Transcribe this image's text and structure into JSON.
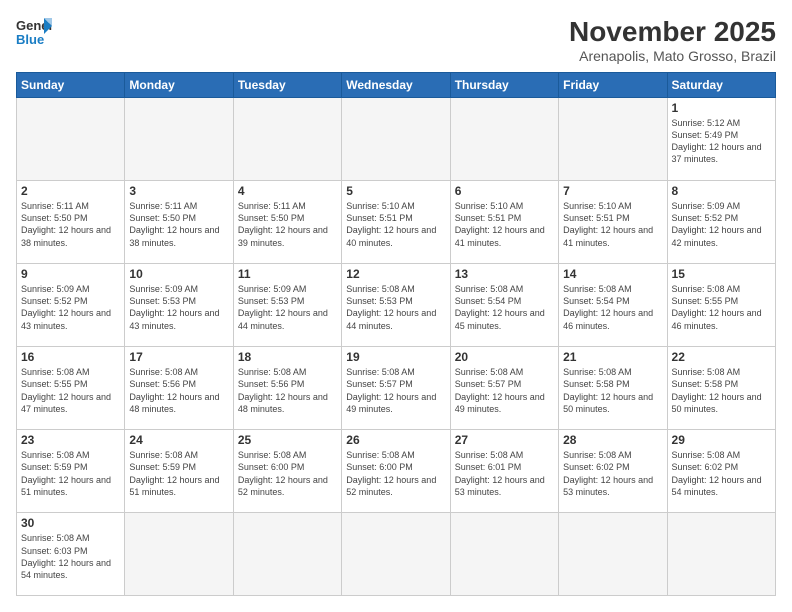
{
  "header": {
    "logo_general": "General",
    "logo_blue": "Blue",
    "month_title": "November 2025",
    "location": "Arenapolis, Mato Grosso, Brazil"
  },
  "weekdays": [
    "Sunday",
    "Monday",
    "Tuesday",
    "Wednesday",
    "Thursday",
    "Friday",
    "Saturday"
  ],
  "weeks": [
    [
      {
        "day": "",
        "info": ""
      },
      {
        "day": "",
        "info": ""
      },
      {
        "day": "",
        "info": ""
      },
      {
        "day": "",
        "info": ""
      },
      {
        "day": "",
        "info": ""
      },
      {
        "day": "",
        "info": ""
      },
      {
        "day": "1",
        "info": "Sunrise: 5:12 AM\nSunset: 5:49 PM\nDaylight: 12 hours and 37 minutes."
      }
    ],
    [
      {
        "day": "2",
        "info": "Sunrise: 5:11 AM\nSunset: 5:50 PM\nDaylight: 12 hours and 38 minutes."
      },
      {
        "day": "3",
        "info": "Sunrise: 5:11 AM\nSunset: 5:50 PM\nDaylight: 12 hours and 38 minutes."
      },
      {
        "day": "4",
        "info": "Sunrise: 5:11 AM\nSunset: 5:50 PM\nDaylight: 12 hours and 39 minutes."
      },
      {
        "day": "5",
        "info": "Sunrise: 5:10 AM\nSunset: 5:51 PM\nDaylight: 12 hours and 40 minutes."
      },
      {
        "day": "6",
        "info": "Sunrise: 5:10 AM\nSunset: 5:51 PM\nDaylight: 12 hours and 41 minutes."
      },
      {
        "day": "7",
        "info": "Sunrise: 5:10 AM\nSunset: 5:51 PM\nDaylight: 12 hours and 41 minutes."
      },
      {
        "day": "8",
        "info": "Sunrise: 5:09 AM\nSunset: 5:52 PM\nDaylight: 12 hours and 42 minutes."
      }
    ],
    [
      {
        "day": "9",
        "info": "Sunrise: 5:09 AM\nSunset: 5:52 PM\nDaylight: 12 hours and 43 minutes."
      },
      {
        "day": "10",
        "info": "Sunrise: 5:09 AM\nSunset: 5:53 PM\nDaylight: 12 hours and 43 minutes."
      },
      {
        "day": "11",
        "info": "Sunrise: 5:09 AM\nSunset: 5:53 PM\nDaylight: 12 hours and 44 minutes."
      },
      {
        "day": "12",
        "info": "Sunrise: 5:08 AM\nSunset: 5:53 PM\nDaylight: 12 hours and 44 minutes."
      },
      {
        "day": "13",
        "info": "Sunrise: 5:08 AM\nSunset: 5:54 PM\nDaylight: 12 hours and 45 minutes."
      },
      {
        "day": "14",
        "info": "Sunrise: 5:08 AM\nSunset: 5:54 PM\nDaylight: 12 hours and 46 minutes."
      },
      {
        "day": "15",
        "info": "Sunrise: 5:08 AM\nSunset: 5:55 PM\nDaylight: 12 hours and 46 minutes."
      }
    ],
    [
      {
        "day": "16",
        "info": "Sunrise: 5:08 AM\nSunset: 5:55 PM\nDaylight: 12 hours and 47 minutes."
      },
      {
        "day": "17",
        "info": "Sunrise: 5:08 AM\nSunset: 5:56 PM\nDaylight: 12 hours and 48 minutes."
      },
      {
        "day": "18",
        "info": "Sunrise: 5:08 AM\nSunset: 5:56 PM\nDaylight: 12 hours and 48 minutes."
      },
      {
        "day": "19",
        "info": "Sunrise: 5:08 AM\nSunset: 5:57 PM\nDaylight: 12 hours and 49 minutes."
      },
      {
        "day": "20",
        "info": "Sunrise: 5:08 AM\nSunset: 5:57 PM\nDaylight: 12 hours and 49 minutes."
      },
      {
        "day": "21",
        "info": "Sunrise: 5:08 AM\nSunset: 5:58 PM\nDaylight: 12 hours and 50 minutes."
      },
      {
        "day": "22",
        "info": "Sunrise: 5:08 AM\nSunset: 5:58 PM\nDaylight: 12 hours and 50 minutes."
      }
    ],
    [
      {
        "day": "23",
        "info": "Sunrise: 5:08 AM\nSunset: 5:59 PM\nDaylight: 12 hours and 51 minutes."
      },
      {
        "day": "24",
        "info": "Sunrise: 5:08 AM\nSunset: 5:59 PM\nDaylight: 12 hours and 51 minutes."
      },
      {
        "day": "25",
        "info": "Sunrise: 5:08 AM\nSunset: 6:00 PM\nDaylight: 12 hours and 52 minutes."
      },
      {
        "day": "26",
        "info": "Sunrise: 5:08 AM\nSunset: 6:00 PM\nDaylight: 12 hours and 52 minutes."
      },
      {
        "day": "27",
        "info": "Sunrise: 5:08 AM\nSunset: 6:01 PM\nDaylight: 12 hours and 53 minutes."
      },
      {
        "day": "28",
        "info": "Sunrise: 5:08 AM\nSunset: 6:02 PM\nDaylight: 12 hours and 53 minutes."
      },
      {
        "day": "29",
        "info": "Sunrise: 5:08 AM\nSunset: 6:02 PM\nDaylight: 12 hours and 54 minutes."
      }
    ],
    [
      {
        "day": "30",
        "info": "Sunrise: 5:08 AM\nSunset: 6:03 PM\nDaylight: 12 hours and 54 minutes."
      },
      {
        "day": "",
        "info": ""
      },
      {
        "day": "",
        "info": ""
      },
      {
        "day": "",
        "info": ""
      },
      {
        "day": "",
        "info": ""
      },
      {
        "day": "",
        "info": ""
      },
      {
        "day": "",
        "info": ""
      }
    ]
  ]
}
